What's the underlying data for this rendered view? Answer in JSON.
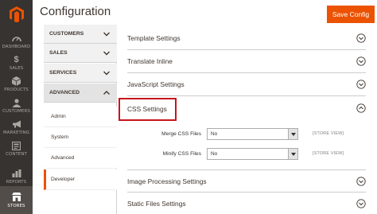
{
  "header": {
    "title": "Configuration",
    "save_label": "Save Config"
  },
  "admin_nav": {
    "items": [
      {
        "label": "DASHBOARD",
        "icon": "dashboard-icon"
      },
      {
        "label": "SALES",
        "icon": "dollar-icon"
      },
      {
        "label": "PRODUCTS",
        "icon": "cube-icon"
      },
      {
        "label": "CUSTOMERS",
        "icon": "customers-icon"
      },
      {
        "label": "MARKETING",
        "icon": "megaphone-icon"
      },
      {
        "label": "CONTENT",
        "icon": "content-icon"
      },
      {
        "label": "REPORTS",
        "icon": "bar-chart-icon"
      },
      {
        "label": "STORES",
        "icon": "store-icon"
      }
    ],
    "active": "STORES"
  },
  "config_nav": {
    "sections": [
      {
        "label": "CUSTOMERS",
        "state": "collapsed"
      },
      {
        "label": "SALES",
        "state": "collapsed"
      },
      {
        "label": "SERVICES",
        "state": "collapsed"
      },
      {
        "label": "ADVANCED",
        "state": "expanded"
      }
    ],
    "advanced_items": [
      "Admin",
      "System",
      "Advanced",
      "Developer"
    ],
    "active_item": "Developer"
  },
  "main": {
    "groups": [
      {
        "label": "Template Settings"
      },
      {
        "label": "Translate Inline"
      },
      {
        "label": "JavaScript Settings"
      },
      {
        "label": "CSS Settings"
      },
      {
        "label": "Image Processing Settings"
      },
      {
        "label": "Static Files Settings"
      }
    ],
    "css_fields": [
      {
        "label": "Merge CSS Files",
        "value": "No",
        "scope": "[STORE VIEW]"
      },
      {
        "label": "Minify CSS Files",
        "value": "No",
        "scope": "[STORE VIEW]"
      }
    ]
  },
  "colors": {
    "accent": "#eb5202",
    "nav_bg": "#373330",
    "highlight": "#c8141b"
  }
}
